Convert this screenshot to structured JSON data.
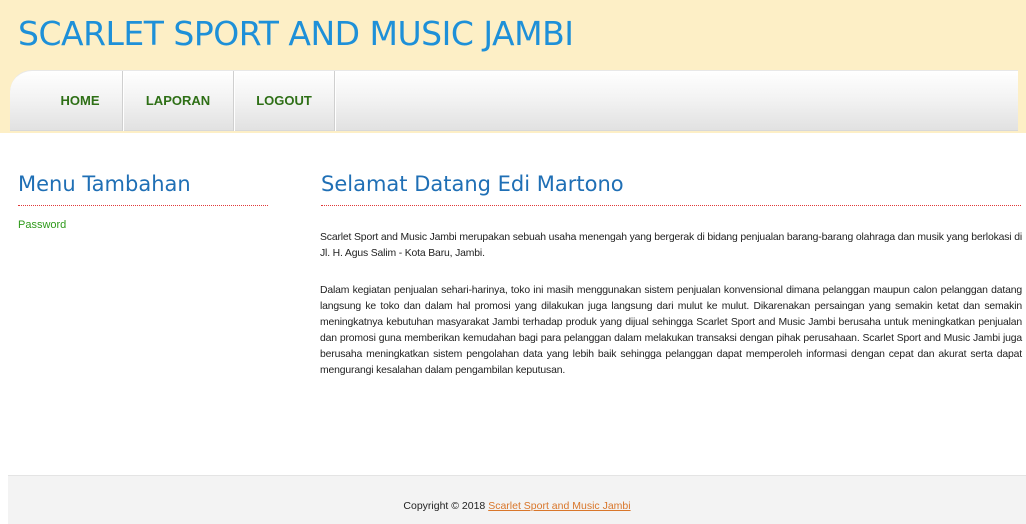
{
  "header": {
    "site_title": "SCARLET SPORT AND MUSIC JAMBI"
  },
  "nav": {
    "items": [
      {
        "label": "HOME"
      },
      {
        "label": "LAPORAN"
      },
      {
        "label": "LOGOUT"
      }
    ]
  },
  "sidebar": {
    "title": "Menu Tambahan",
    "links": [
      {
        "label": "Password"
      }
    ]
  },
  "main": {
    "title": "Selamat Datang Edi Martono",
    "paragraphs": [
      "Scarlet Sport and Music Jambi merupakan sebuah usaha menengah yang bergerak di bidang penjualan barang-barang olahraga dan musik yang berlokasi di Jl. H. Agus Salim - Kota Baru, Jambi.",
      "Dalam kegiatan penjualan sehari-harinya, toko ini masih menggunakan sistem penjualan konvensional dimana pelanggan maupun calon pelanggan datang langsung ke toko dan dalam hal promosi yang dilakukan juga langsung dari mulut ke mulut. Dikarenakan persaingan yang semakin ketat dan semakin meningkatnya kebutuhan masyarakat Jambi terhadap produk yang dijual sehingga Scarlet Sport and Music Jambi berusaha untuk meningkatkan penjualan dan promosi guna memberikan kemudahan bagi para pelanggan dalam melakukan transaksi dengan pihak perusahaan. Scarlet Sport and Music Jambi juga berusaha meningkatkan sistem pengolahan data yang lebih baik sehingga pelanggan dapat memperoleh informasi dengan cepat dan akurat serta dapat mengurangi kesalahan dalam pengambilan keputusan."
    ]
  },
  "footer": {
    "copyright_prefix": "Copyright © 2018 ",
    "link_label": "Scarlet Sport and Music Jambi"
  }
}
